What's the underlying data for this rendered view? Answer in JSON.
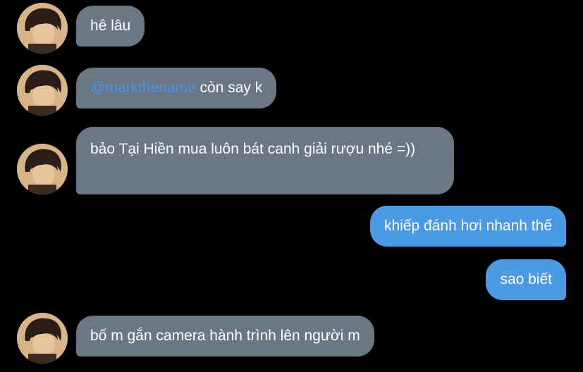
{
  "colors": {
    "background": "#000000",
    "incoming_bubble": "#6b7784",
    "outgoing_bubble": "#4a9ae6",
    "mention": "#4b95e0"
  },
  "avatar": {
    "icon": "user-avatar-photo"
  },
  "messages": [
    {
      "side": "incoming",
      "text": "hê lâu"
    },
    {
      "side": "incoming",
      "mention": "@markthename",
      "text": " còn say k"
    },
    {
      "side": "incoming",
      "text": "bảo Tại Hiền mua luôn bát canh giải rượu nhé =))"
    },
    {
      "side": "outgoing",
      "text": "khiếp đánh hơi nhanh thế"
    },
    {
      "side": "outgoing",
      "text": "sao biết"
    },
    {
      "side": "incoming",
      "text": "bố m gắn camera hành trình lên người m"
    }
  ]
}
